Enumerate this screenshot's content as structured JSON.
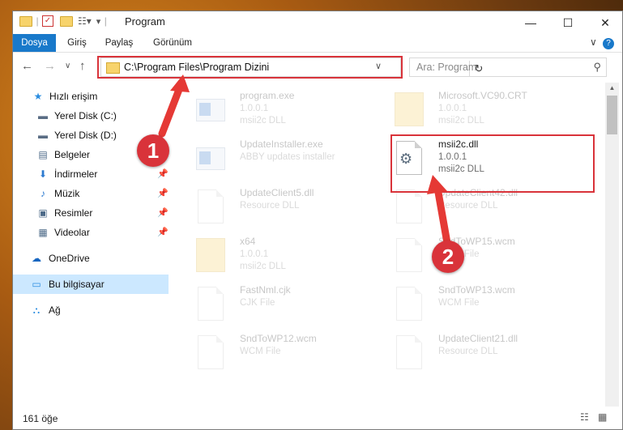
{
  "window": {
    "title": "Program"
  },
  "ribbon": {
    "tabs": [
      {
        "label": "Dosya",
        "active": true
      },
      {
        "label": "Giriş"
      },
      {
        "label": "Paylaş"
      },
      {
        "label": "Görünüm"
      }
    ]
  },
  "address": {
    "path": "C:\\Program Files\\Program Dizini"
  },
  "search": {
    "placeholder": "Ara: Program"
  },
  "nav": {
    "items": [
      {
        "label": "Hızlı erişim",
        "icon": "star-icon",
        "color": "#2b8de0"
      },
      {
        "label": "Yerel Disk (C:)",
        "icon": "drive-icon",
        "color": "#5a6d84"
      },
      {
        "label": "Yerel Disk (D:)",
        "icon": "drive-icon",
        "color": "#5a6d84"
      },
      {
        "label": "Belgeler",
        "icon": "documents-icon",
        "color": "#4d6a88"
      },
      {
        "label": "İndirmeler",
        "icon": "download-icon",
        "color": "#2b7ad0",
        "pinned": true
      },
      {
        "label": "Müzik",
        "icon": "music-icon",
        "color": "#2b7ad0",
        "pinned": true
      },
      {
        "label": "Resimler",
        "icon": "pictures-icon",
        "color": "#4d6a88",
        "pinned": true
      },
      {
        "label": "Videolar",
        "icon": "video-icon",
        "color": "#4d6a88",
        "pinned": true
      },
      {
        "label": "OneDrive",
        "icon": "cloud-icon",
        "color": "#1565c0"
      },
      {
        "label": "Bu bilgisayar",
        "icon": "computer-icon",
        "color": "#2b8de0",
        "selected": true
      },
      {
        "label": "Ağ",
        "icon": "network-icon",
        "color": "#2b8de0"
      }
    ]
  },
  "files": [
    {
      "name": "program.exe",
      "sub1": "1.0.0.1",
      "sub2": "msii2c DLL",
      "kind": "exe",
      "faded": true
    },
    {
      "name": "Microsoft.VC90.CRT",
      "sub1": "1.0.0.1",
      "sub2": "msii2c DLL",
      "kind": "folder",
      "faded": true
    },
    {
      "name": "UpdateInstaller.exe",
      "sub1": "ABBY updates installer",
      "sub2": "",
      "kind": "exe",
      "faded": true
    },
    {
      "name": "msii2c.dll",
      "sub1": "1.0.0.1",
      "sub2": "msii2c DLL",
      "kind": "dll",
      "faded": false
    },
    {
      "name": "UpdateClient5.dll",
      "sub1": "Resource DLL",
      "sub2": "",
      "kind": "doc",
      "faded": true
    },
    {
      "name": "UpdateClient42.dll",
      "sub1": "Resource DLL",
      "sub2": "",
      "kind": "doc",
      "faded": true
    },
    {
      "name": "x64",
      "sub1": "1.0.0.1",
      "sub2": "msii2c DLL",
      "kind": "folder",
      "faded": true
    },
    {
      "name": "SndToWP15.wcm",
      "sub1": "WCM File",
      "sub2": "",
      "kind": "doc",
      "faded": true
    },
    {
      "name": "FastNml.cjk",
      "sub1": "CJK File",
      "sub2": "",
      "kind": "doc",
      "faded": true
    },
    {
      "name": "SndToWP13.wcm",
      "sub1": "WCM File",
      "sub2": "",
      "kind": "doc",
      "faded": true
    },
    {
      "name": "SndToWP12.wcm",
      "sub1": "WCM File",
      "sub2": "",
      "kind": "doc",
      "faded": true
    },
    {
      "name": "UpdateClient21.dll",
      "sub1": "Resource DLL",
      "sub2": "",
      "kind": "doc",
      "faded": true
    }
  ],
  "status": {
    "count": "161 öğe"
  },
  "annotations": [
    {
      "number": "1",
      "color": "#d9333a"
    },
    {
      "number": "2",
      "color": "#d9333a"
    }
  ]
}
